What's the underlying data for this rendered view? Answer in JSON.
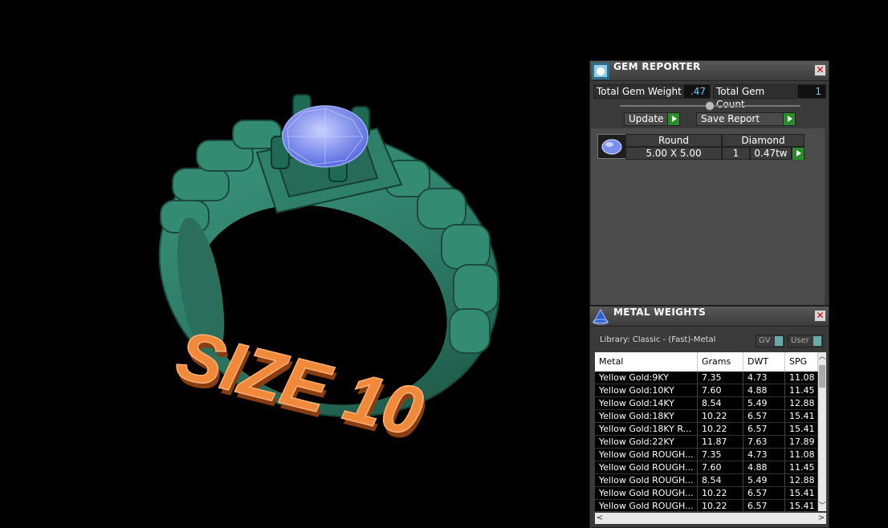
{
  "viewport": {
    "size_label": "SIZE 10",
    "colors": {
      "ring": "#2e7d68",
      "ring_dark": "#1f5647",
      "gem": "#7b8ef0",
      "text3d": "#f08a3a"
    }
  },
  "gem_reporter": {
    "title": "GEM REPORTER",
    "total_gem_weight_label": "Total Gem Weight",
    "total_gem_weight_value": ".47",
    "total_gem_count_label": "Total Gem Count",
    "total_gem_count_value": "1",
    "update_label": "Update",
    "save_report_label": "Save Report",
    "gem": {
      "shape": "Round",
      "type": "Diamond",
      "size": "5.00 X 5.00",
      "count": "1",
      "weight": "0.47tw"
    }
  },
  "metal_weights": {
    "title": "METAL WEIGHTS",
    "library_label": "Library: Classic - (Fast)-Metal",
    "gv_label": "GV",
    "user_label": "User",
    "columns": [
      "Metal",
      "Grams",
      "DWT",
      "SPG"
    ],
    "rows": [
      [
        "Yellow Gold:9KY",
        "7.35",
        "4.73",
        "11.08"
      ],
      [
        "Yellow Gold:10KY",
        "7.60",
        "4.88",
        "11.45"
      ],
      [
        "Yellow Gold:14KY",
        "8.54",
        "5.49",
        "12.88"
      ],
      [
        "Yellow Gold:18KY",
        "10.22",
        "6.57",
        "15.41"
      ],
      [
        "Yellow Gold:18KY R...",
        "10.22",
        "6.57",
        "15.41"
      ],
      [
        "Yellow Gold:22KY",
        "11.87",
        "7.63",
        "17.89"
      ],
      [
        "Yellow Gold ROUGH...",
        "7.35",
        "4.73",
        "11.08"
      ],
      [
        "Yellow Gold ROUGH...",
        "7.60",
        "4.88",
        "11.45"
      ],
      [
        "Yellow Gold ROUGH...",
        "8.54",
        "5.49",
        "12.88"
      ],
      [
        "Yellow Gold ROUGH...",
        "10.22",
        "6.57",
        "15.41"
      ],
      [
        "Yellow Gold ROUGH...",
        "10.22",
        "6.57",
        "15.41"
      ]
    ]
  }
}
